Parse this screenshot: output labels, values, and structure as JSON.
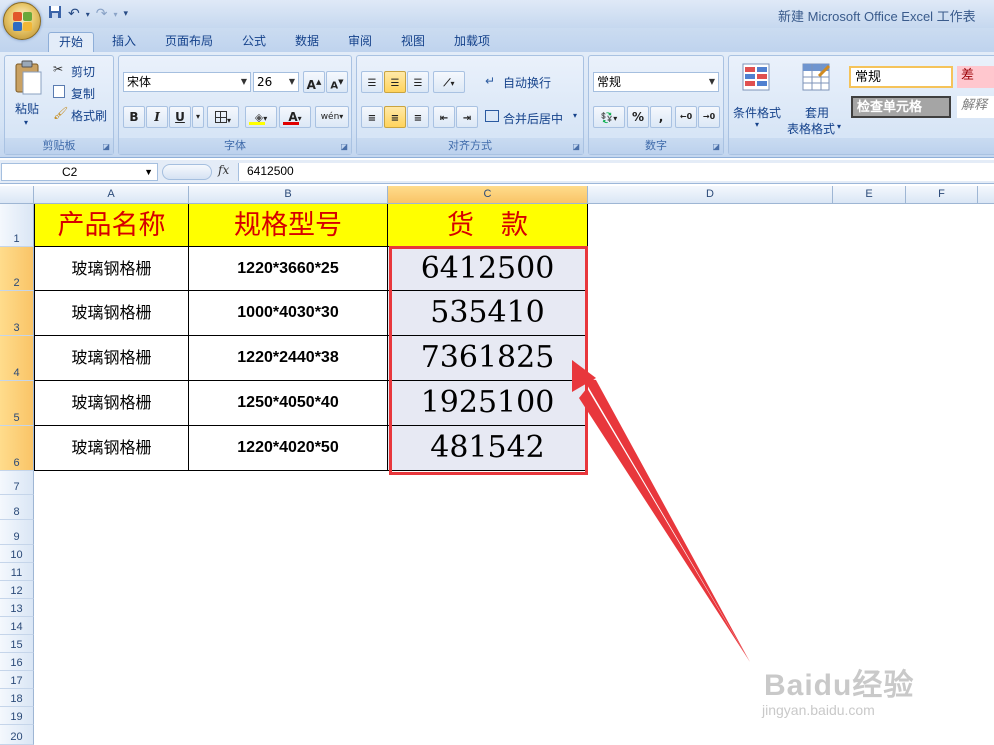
{
  "window": {
    "title": "新建 Microsoft Office Excel 工作表"
  },
  "tabs": [
    "开始",
    "插入",
    "页面布局",
    "公式",
    "数据",
    "审阅",
    "视图",
    "加载项"
  ],
  "ribbon": {
    "clipboard": {
      "paste": "粘贴",
      "cut": "剪切",
      "copy": "复制",
      "format_painter": "格式刷",
      "label": "剪贴板"
    },
    "font": {
      "name": "宋体",
      "size": "26",
      "label": "字体",
      "bold": "B",
      "italic": "I",
      "underline": "U",
      "grow": "A",
      "shrink": "A",
      "font_color": "A",
      "phonetic": "wén"
    },
    "alignment": {
      "wrap": "自动换行",
      "merge": "合并后居中",
      "label": "对齐方式"
    },
    "number": {
      "format": "常规",
      "percent": "%",
      "comma": ",",
      "label": "数字"
    },
    "styles": {
      "conditional": "条件格式",
      "table_line1": "套用",
      "table_line2": "表格格式",
      "normal": "常规",
      "bad": "差",
      "check_cell": "检查单元格",
      "explanatory": "解释"
    }
  },
  "formula_bar": {
    "name_box": "C2",
    "fx": "fx",
    "content": "6412500"
  },
  "columns": [
    "A",
    "B",
    "C",
    "D",
    "E",
    "F"
  ],
  "rows": [
    "1",
    "2",
    "3",
    "4",
    "5",
    "6",
    "7",
    "8",
    "9",
    "10",
    "11",
    "12",
    "13",
    "14",
    "15",
    "16",
    "17",
    "18",
    "19",
    "20"
  ],
  "table": {
    "headers": [
      "产品名称",
      "规格型号",
      "货　款"
    ],
    "rows": [
      {
        "name": "玻璃钢格栅",
        "spec": "1220*3660*25",
        "amount": "6412500"
      },
      {
        "name": "玻璃钢格栅",
        "spec": "1000*4030*30",
        "amount": "535410"
      },
      {
        "name": "玻璃钢格栅",
        "spec": "1220*2440*38",
        "amount": "7361825"
      },
      {
        "name": "玻璃钢格栅",
        "spec": "1250*4050*40",
        "amount": "1925100"
      },
      {
        "name": "玻璃钢格栅",
        "spec": "1220*4020*50",
        "amount": "481542"
      }
    ]
  },
  "watermark": {
    "main": "Baidu经验",
    "sub": "jingyan.baidu.com"
  },
  "colors": {
    "header_fill": "#ffff00",
    "header_text": "#d60000",
    "highlight_border": "#e8373c",
    "arrow": "#e8373c"
  }
}
